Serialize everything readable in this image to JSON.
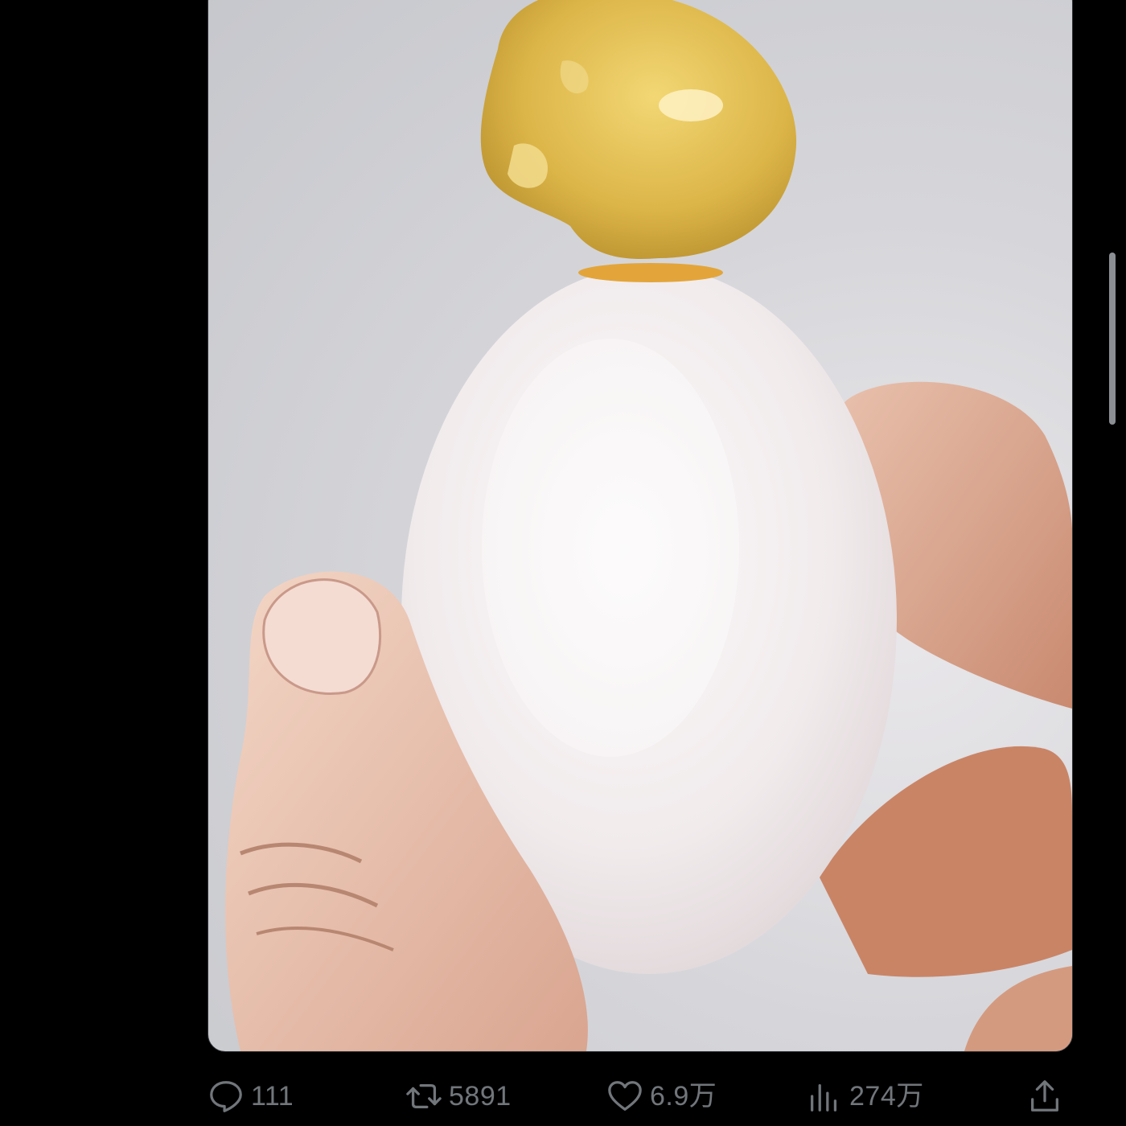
{
  "post": {
    "image_alt_icon": "egg-photo",
    "actions": {
      "reply": {
        "icon": "reply-icon",
        "count": "111"
      },
      "repost": {
        "icon": "repost-icon",
        "count": "5891"
      },
      "like": {
        "icon": "heart-icon",
        "count": "6.9万"
      },
      "views": {
        "icon": "views-icon",
        "count": "274万"
      },
      "share": {
        "icon": "share-icon"
      }
    }
  },
  "colors": {
    "background": "#000000",
    "action_gray": "#71767b",
    "egg_shell": "#f3eeee",
    "yolk": "#d9b545"
  }
}
